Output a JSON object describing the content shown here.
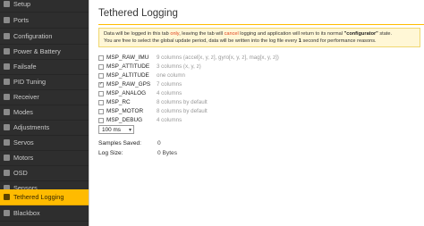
{
  "sidebar": {
    "items": [
      {
        "label": "Setup",
        "icon": "setup-icon",
        "active": false
      },
      {
        "label": "Ports",
        "icon": "ports-icon",
        "active": false
      },
      {
        "label": "Configuration",
        "icon": "configuration-icon",
        "active": false
      },
      {
        "label": "Power & Battery",
        "icon": "battery-icon",
        "active": false
      },
      {
        "label": "Failsafe",
        "icon": "failsafe-icon",
        "active": false
      },
      {
        "label": "PID Tuning",
        "icon": "pid-icon",
        "active": false
      },
      {
        "label": "Receiver",
        "icon": "receiver-icon",
        "active": false
      },
      {
        "label": "Modes",
        "icon": "modes-icon",
        "active": false
      },
      {
        "label": "Adjustments",
        "icon": "adjustments-icon",
        "active": false
      },
      {
        "label": "Servos",
        "icon": "servos-icon",
        "active": false
      },
      {
        "label": "Motors",
        "icon": "motors-icon",
        "active": false
      },
      {
        "label": "OSD",
        "icon": "osd-icon",
        "active": false
      },
      {
        "label": "Sensors",
        "icon": "sensors-icon",
        "active": false
      },
      {
        "label": "Tethered Logging",
        "icon": "logging-icon",
        "active": true
      },
      {
        "label": "Blackbox",
        "icon": "blackbox-icon",
        "active": false
      }
    ]
  },
  "page": {
    "title": "Tethered Logging",
    "notice": {
      "part1": "Data will be logged in this tab ",
      "only": "only",
      "part2": ", leaving the tab will ",
      "cancel": "cancel",
      "part3": " logging and application will return to its normal ",
      "configurator": "\"configurator\"",
      "part4": " state.",
      "part5": "You are free to select the global update period, data will be written into the log file every ",
      "one": "1",
      "part6": " second for performance reasons."
    }
  },
  "log_items": [
    {
      "name": "MSP_RAW_IMU",
      "desc": "9 columns (accel[x, y, z], gyro[x, y, z], mag[x, y, z])",
      "checked": false
    },
    {
      "name": "MSP_ATTITUDE",
      "desc": "3 columns (x, y, z)",
      "checked": false
    },
    {
      "name": "MSP_ALTITUDE",
      "desc": "one column",
      "checked": false
    },
    {
      "name": "MSP_RAW_GPS",
      "desc": "7 columns",
      "checked": true
    },
    {
      "name": "MSP_ANALOG",
      "desc": "4 columns",
      "checked": false
    },
    {
      "name": "MSP_RC",
      "desc": "8 columns by default",
      "checked": false
    },
    {
      "name": "MSP_MOTOR",
      "desc": "8 columns by default",
      "checked": false
    },
    {
      "name": "MSP_DEBUG",
      "desc": "4 columns",
      "checked": false
    }
  ],
  "rate_select": {
    "value": "100 ms"
  },
  "stats": {
    "samples_label": "Samples Saved:",
    "samples_value": "0",
    "size_label": "Log Size:",
    "size_value": "0 Bytes"
  },
  "colors": {
    "accent": "#ffbb00",
    "sidebar_bg": "#2e2e2e",
    "warning": "#e0461f"
  }
}
